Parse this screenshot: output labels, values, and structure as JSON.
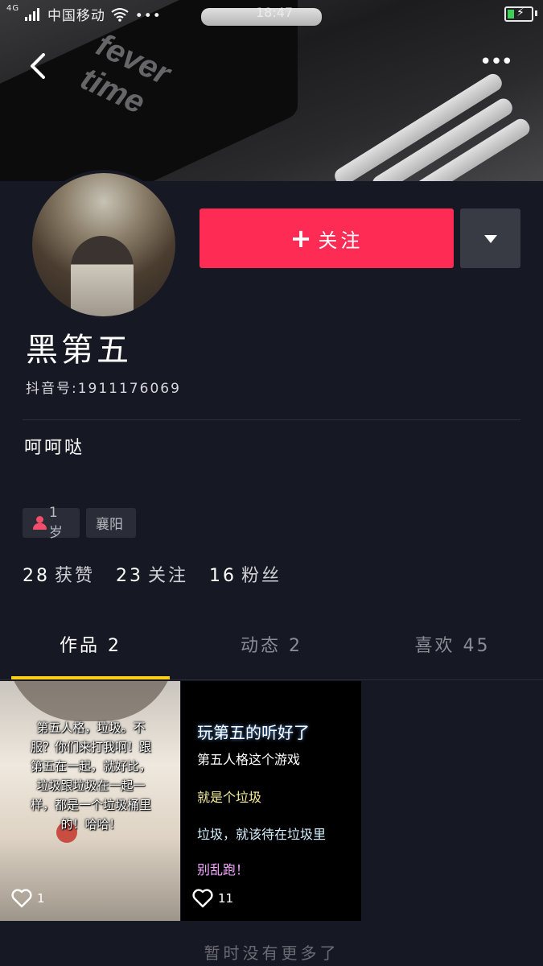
{
  "status_bar": {
    "signal": "4G",
    "carrier": "中国移动",
    "time": "18:47",
    "dots": "•••"
  },
  "cover": {
    "pack_text_line1": "fever",
    "pack_text_line2": "time"
  },
  "header": {
    "more_label": "•••"
  },
  "profile": {
    "follow_label": "关注",
    "follow_plus": "+",
    "nickname": "黑第五",
    "douyin_id": "抖音号:1911176069",
    "bio": "呵呵哒",
    "tags": {
      "age": "1岁",
      "location": "襄阳"
    },
    "stats": [
      {
        "num": "28",
        "label": "获赞"
      },
      {
        "num": "23",
        "label": "关注"
      },
      {
        "num": "16",
        "label": "粉丝"
      }
    ]
  },
  "tabs": [
    {
      "label": "作品 2"
    },
    {
      "label": "动态 2"
    },
    {
      "label": "喜欢 45"
    }
  ],
  "grid": [
    {
      "caption_lines": [
        "第五人格，垃圾。不",
        "服？你们来打我啊！跟",
        "第五在一起，就好比，",
        "垃圾跟垃圾在一起一",
        "样，都是一个垃圾桶里",
        "的！哈哈！"
      ],
      "likes": "1"
    },
    {
      "title": "玩第五的听好了",
      "lines": [
        "第五人格这个游戏",
        "就是个垃圾",
        "垃圾，就该待在垃圾里",
        "别乱跑！"
      ],
      "likes": "11"
    }
  ],
  "footer": {
    "no_more": "暂时没有更多了"
  },
  "colors": {
    "background": "#161823",
    "follow_button": "#fe2c55",
    "tab_underline": "#face15"
  }
}
